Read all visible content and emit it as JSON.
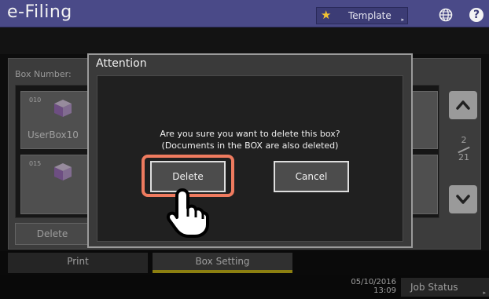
{
  "header": {
    "app_title": "e-Filing",
    "template_label": "Template"
  },
  "background": {
    "box_number_label": "Box Number:",
    "boxes": [
      {
        "number": "010",
        "name": "UserBox10"
      },
      {
        "number": "015",
        "name": ""
      }
    ],
    "page_current": "2",
    "page_total": "21",
    "delete_label": "Delete"
  },
  "tabs": [
    {
      "label": "Print"
    },
    {
      "label": "Box Setting"
    }
  ],
  "status": {
    "date": "05/10/2016",
    "time": "13:09",
    "job_status_label": "Job Status"
  },
  "dialog": {
    "title": "Attention",
    "message_line1": "Are you sure you want to delete this box?",
    "message_line2": "(Documents in the BOX are also deleted)",
    "delete_label": "Delete",
    "cancel_label": "Cancel"
  },
  "colors": {
    "header": "#4a4a88",
    "highlight": "#ef7b5f",
    "tab_active_underline": "#d8c31a",
    "star": "#f1c232"
  },
  "icons": [
    "star-icon",
    "globe-icon",
    "help-icon",
    "box-cube-icon",
    "scroll-up-icon",
    "scroll-down-icon",
    "pointing-hand-icon"
  ]
}
